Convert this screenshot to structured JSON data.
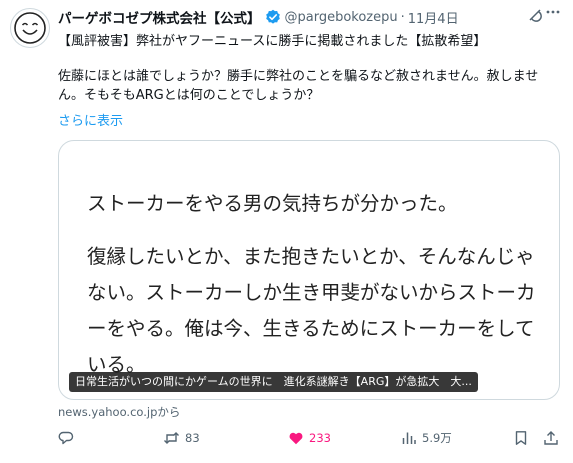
{
  "tweet": {
    "display_name": "パーゲボコゼプ株式会社【公式】",
    "handle": "@pargebokozepu",
    "separator": "·",
    "date": "11月4日",
    "headline": "【風評被害】弊社がヤフーニュースに勝手に掲載されました【拡散希望】",
    "body": "佐藤にほとは誰でしょうか？勝手に弊社のことを騙るなど赦されません。赦しません。そもそもARGとは何のことでしょうか？",
    "show_more": "さらに表示"
  },
  "card": {
    "paragraph1": "ストーカーをやる男の気持ちが分かった。",
    "paragraph2": "復縁したいとか、また抱きたいとか、そんなんじゃない。ストーカーしか生き甲斐がないからストーカーをやる。俺は今、生きるためにストーカーをしている。",
    "caption": "日常生活がいつの間にかゲームの世界に　進化系謎解き【ARG】が急拡大　大...",
    "source": "news.yahoo.co.jpから"
  },
  "actions": {
    "retweets": "83",
    "likes": "233",
    "views": "5.9万"
  },
  "colors": {
    "accent": "#1d9bf0",
    "like": "#f91880",
    "muted": "#536471",
    "text": "#0f1419",
    "border": "#cfd9de"
  },
  "icons": [
    "avatar-smiley",
    "verified-badge-icon",
    "grok-icon",
    "more-icon",
    "reply-icon",
    "retweet-icon",
    "like-icon",
    "views-icon",
    "bookmark-icon",
    "share-icon"
  ]
}
